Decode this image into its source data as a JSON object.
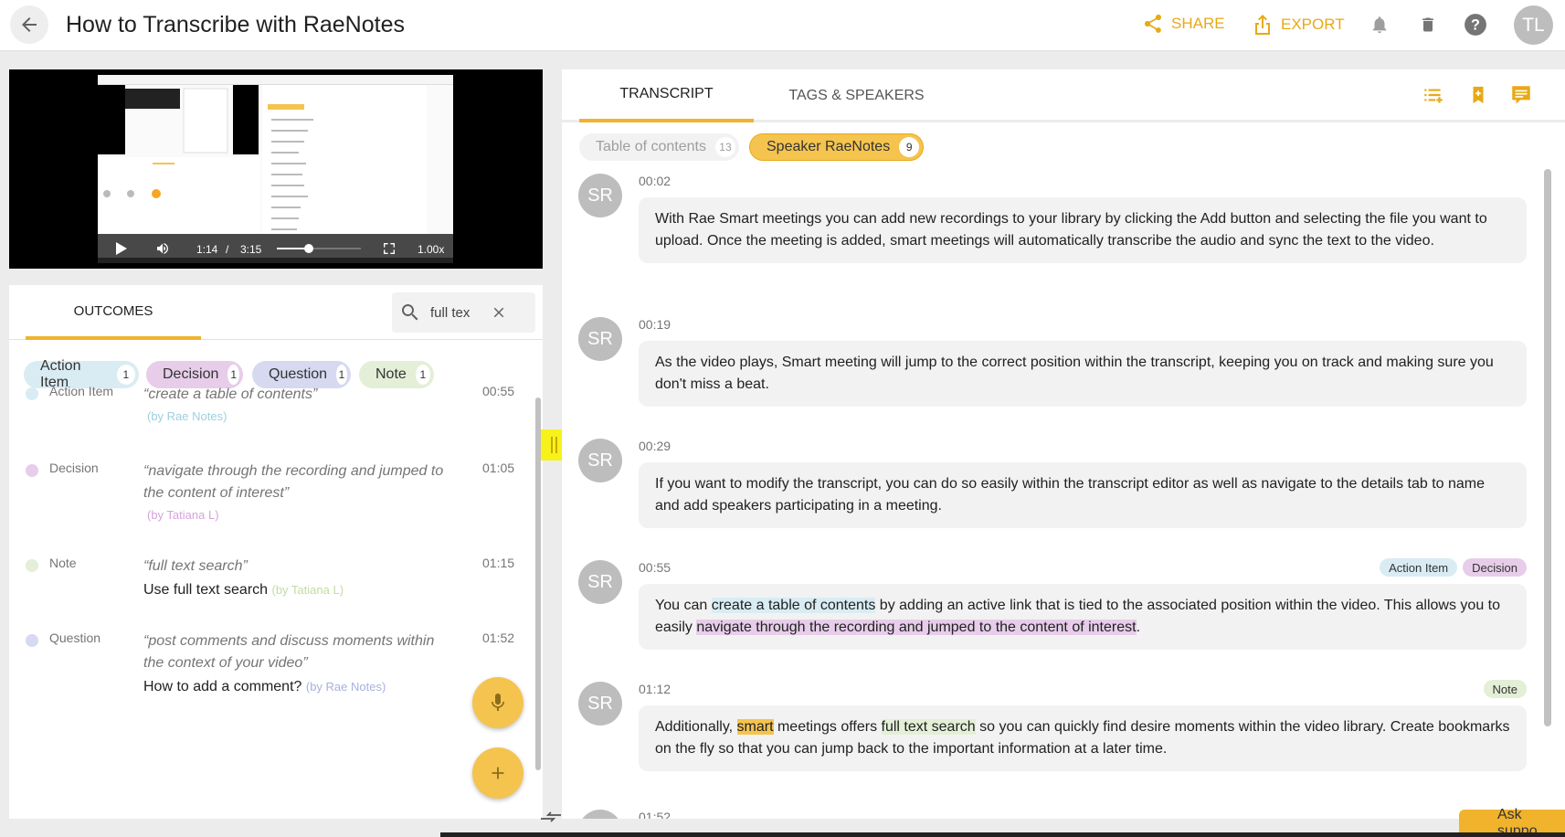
{
  "header": {
    "title": "How to Transcribe with RaeNotes",
    "share_label": "SHARE",
    "export_label": "EXPORT",
    "user_initials": "TL",
    "accent_color": "#f0b32b"
  },
  "video": {
    "current_time": "1:14",
    "separator": "/",
    "duration": "3:15",
    "speed": "1.00x",
    "progress_fraction": 0.38
  },
  "outcomes": {
    "tab_label": "OUTCOMES",
    "search_value": "full tex",
    "chips": [
      {
        "label": "Action Item",
        "count": "1",
        "color": "#d9ecf3"
      },
      {
        "label": "Decision",
        "count": "1",
        "color": "#e7cdea"
      },
      {
        "label": "Question",
        "count": "1",
        "color": "#d6d9f0"
      },
      {
        "label": "Note",
        "count": "1",
        "color": "#e3efd6"
      }
    ],
    "items": [
      {
        "type": "Action Item",
        "quote": "“create a table of contents”",
        "by": "(by Rae Notes)",
        "note": "",
        "time": "00:55",
        "dot": "#d9ecf3",
        "by_color": "#9ecfe0"
      },
      {
        "type": "Decision",
        "quote": "“navigate through the recording and jumped to the content of interest”",
        "by": "(by Tatiana L)",
        "note": "",
        "time": "01:05",
        "dot": "#e7cdea",
        "by_color": "#d7a3dc"
      },
      {
        "type": "Note",
        "quote": "“full text search”",
        "by": "(by Tatiana L)",
        "note": "Use full text search",
        "time": "01:15",
        "dot": "#e3efd6",
        "by_color": "#c1dca3"
      },
      {
        "type": "Question",
        "quote": "“post comments and discuss moments within the context of your video”",
        "by": "(by Rae Notes)",
        "note": "How to add a comment?",
        "time": "01:52",
        "dot": "#d6d9f0",
        "by_color": "#a9b0dd"
      }
    ]
  },
  "transcript": {
    "tab_transcript": "TRANSCRIPT",
    "tab_tags": "TAGS & SPEAKERS",
    "filters": [
      {
        "label": "Table of contents",
        "count": "13"
      },
      {
        "label": "Speaker RaeNotes",
        "count": "9"
      }
    ],
    "entries": [
      {
        "speaker": "SR",
        "time": "00:02",
        "text": "With Rae Smart meetings you can add new recordings to your library by clicking the Add button and selecting the file you want to upload. Once the meeting is added, smart meetings will automatically transcribe the audio and sync the text to the video."
      },
      {
        "speaker": "SR",
        "time": "00:19",
        "text": "As the video plays, Smart meeting will jump to the correct position within the transcript, keeping you on track and making sure you don't miss a beat."
      },
      {
        "speaker": "SR",
        "time": "00:29",
        "text": "If you want to modify the transcript, you can do so easily within the transcript editor as well as navigate to the details tab to name and add speakers participating in a meeting."
      },
      {
        "speaker": "SR",
        "time": "00:55",
        "tags": [
          "Action Item",
          "Decision"
        ],
        "t1": "You can ",
        "h1": "create a table of contents",
        "t2": " by adding an active link that is tied to the associated position within the video. This allows you to easily ",
        "h2": "navigate through the recording and jumped to the content of interest",
        "t3": "."
      },
      {
        "speaker": "SR",
        "time": "01:12",
        "tags": [
          "Note"
        ],
        "t1": "Additionally, ",
        "h1": "smart",
        "t2": " meetings offers ",
        "h2": "full text search",
        "t3": " so you can quickly find desire moments within the video library. Create bookmarks on the fly so that you can jump back to the important information at a later time."
      },
      {
        "speaker": "SR",
        "time": "01:52"
      }
    ]
  },
  "support": {
    "label": "Ask suppo"
  }
}
